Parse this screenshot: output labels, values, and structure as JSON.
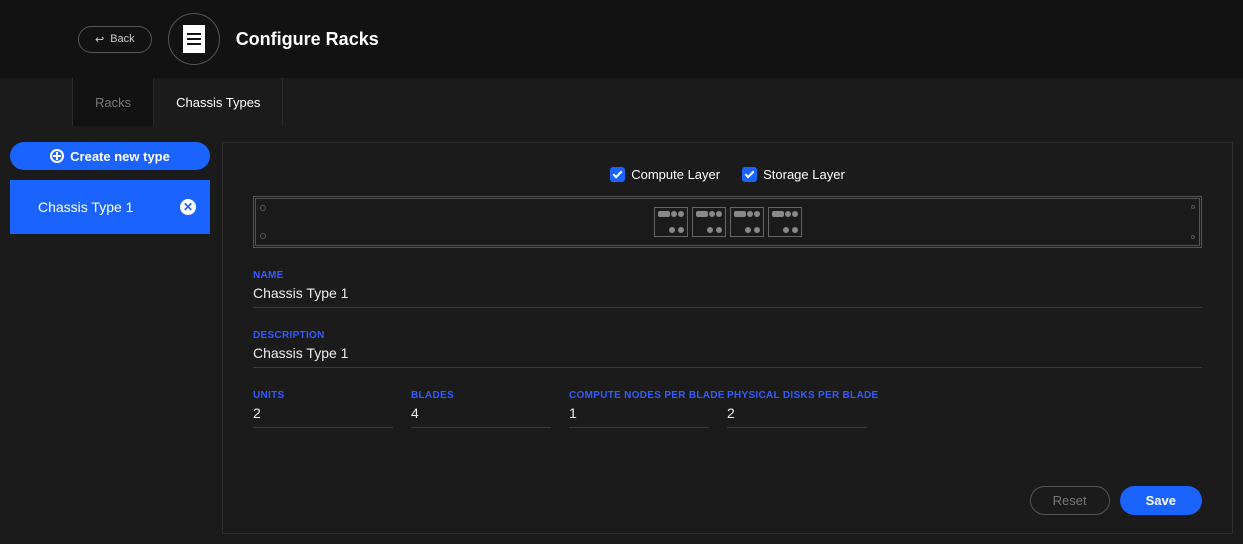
{
  "header": {
    "back_label": "Back",
    "title": "Configure Racks"
  },
  "tabs": [
    {
      "label": "Racks",
      "active": false
    },
    {
      "label": "Chassis Types",
      "active": true
    }
  ],
  "sidebar": {
    "create_label": "Create new type",
    "types": [
      {
        "label": "Chassis Type 1"
      }
    ]
  },
  "layer_checks": [
    {
      "label": "Compute Layer",
      "checked": true
    },
    {
      "label": "Storage Layer",
      "checked": true
    }
  ],
  "form": {
    "name": {
      "label": "NAME",
      "value": "Chassis Type 1"
    },
    "description": {
      "label": "DESCRIPTION",
      "value": "Chassis Type 1"
    },
    "units": {
      "label": "UNITS",
      "value": "2"
    },
    "blades": {
      "label": "BLADES",
      "value": "4"
    },
    "compute_nodes": {
      "label": "COMPUTE NODES PER BLADE",
      "value": "1"
    },
    "physical_disks": {
      "label": "PHYSICAL DISKS PER BLADE",
      "value": "2"
    }
  },
  "buttons": {
    "reset": "Reset",
    "save": "Save"
  }
}
